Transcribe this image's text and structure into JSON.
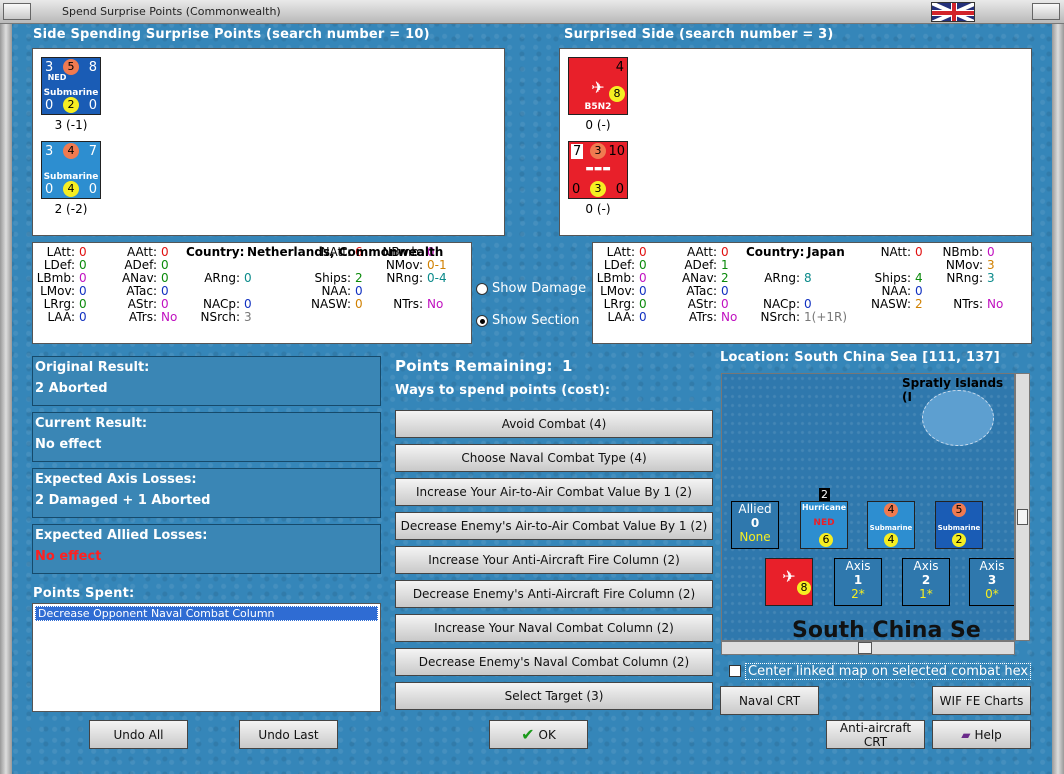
{
  "window": {
    "title": "Spend Surprise Points (Commonwealth)"
  },
  "left_side": {
    "header": "Side Spending Surprise Points (search number = 10)",
    "units": [
      {
        "tl": "3",
        "tc": "5",
        "tr": "8",
        "nation": "NED",
        "type": "Submarine",
        "bl": "0",
        "bc": "2",
        "br": "0",
        "caption": "3 (-1)",
        "color": "#1a5cb5"
      },
      {
        "tl": "3",
        "tc": "4",
        "tr": "7",
        "nation": "",
        "type": "Submarine",
        "bl": "0",
        "bc": "4",
        "br": "0",
        "caption": "2 (-2)",
        "color": "#2d8ed0"
      }
    ]
  },
  "right_side": {
    "header": "Surprised Side (search number = 3)",
    "units": [
      {
        "tl": "",
        "tc": "",
        "tr": "4",
        "type": "B5N2",
        "bc": "8",
        "caption": "0 (-)",
        "color": "#e8202a"
      },
      {
        "tl": "7",
        "tc": "3",
        "tr": "10",
        "type": "",
        "bl": "0",
        "bc": "3",
        "br": "0",
        "caption": "0 (-)",
        "color": "#e8202a"
      }
    ]
  },
  "left_stats": {
    "country_label": "Country:",
    "country": "Netherlands, Commonwealth",
    "LAtt": "0",
    "AAtt": "0",
    "NAtt": "6",
    "NBmb": "0",
    "LDef": "0",
    "ADef": "0",
    "Ships": "2",
    "NMov": "0-1",
    "LBmb": "0",
    "ANav": "0",
    "ARng": "0",
    "NAA": "0",
    "NRng": "0-4",
    "LMov": "0",
    "ATac": "0",
    "NASW": "0",
    "NTrs": "No",
    "LRrg": "0",
    "AStr": "0",
    "NACp": "0",
    "LAA": "0",
    "ATrs": "No",
    "NSrch": "3"
  },
  "right_stats": {
    "country_label": "Country:",
    "country": "Japan",
    "LAtt": "0",
    "AAtt": "0",
    "NAtt": "0",
    "NBmb": "0",
    "LDef": "0",
    "ADef": "1",
    "Ships": "4",
    "NMov": "3",
    "LBmb": "0",
    "ANav": "2",
    "ARng": "8",
    "NAA": "0",
    "NRng": "3",
    "LMov": "0",
    "ATac": "0",
    "NASW": "2",
    "NTrs": "No",
    "LRrg": "0",
    "AStr": "0",
    "NACp": "0",
    "LAA": "0",
    "ATrs": "No",
    "NSrch": "1(+1R)"
  },
  "labels": {
    "LAtt": "LAtt:",
    "AAtt": "AAtt:",
    "NAtt": "NAtt:",
    "NBmb": "NBmb:",
    "LDef": "LDef:",
    "ADef": "ADef:",
    "Ships": "Ships:",
    "NMov": "NMov:",
    "LBmb": "LBmb:",
    "ANav": "ANav:",
    "ARng": "ARng:",
    "NAA": "NAA:",
    "NRng": "NRng:",
    "LMov": "LMov:",
    "ATac": "ATac:",
    "NASW": "NASW:",
    "NTrs": "NTrs:",
    "LRrg": "LRrg:",
    "AStr": "AStr:",
    "NACp": "NACp:",
    "LAA": "LAA:",
    "ATrs": "ATrs:",
    "NSrch": "NSrch:"
  },
  "view": {
    "show_damage": "Show Damage",
    "show_section": "Show Section",
    "selected": "section"
  },
  "results": {
    "original_title": "Original Result:",
    "original_value": "2 Aborted",
    "current_title": "Current Result:",
    "current_value": "No effect",
    "axis_title": "Expected Axis Losses:",
    "axis_value": "2 Damaged + 1 Aborted",
    "allied_title": "Expected Allied Losses:",
    "allied_value": "No effect"
  },
  "points_spent": {
    "title": "Points Spent:",
    "items": [
      "Decrease Opponent Naval Combat Column"
    ]
  },
  "points": {
    "remaining_label": "Points Remaining:",
    "remaining_value": "1",
    "ways_label": "Ways to spend points (cost):"
  },
  "ways": [
    "Avoid Combat (4)",
    "Choose Naval Combat Type (4)",
    "Increase Your Air-to-Air Combat Value By 1 (2)",
    "Decrease Enemy's Air-to-Air Combat Value By 1 (2)",
    "Increase Your Anti-Aircraft Fire Column (2)",
    "Decrease Enemy's Anti-Aircraft Fire Column (2)",
    "Increase Your Naval Combat Column (2)",
    "Decrease Enemy's Naval Combat Column (2)",
    "Select Target (3)"
  ],
  "map": {
    "location": "Location: South China Sea [111, 137]",
    "island": "Spratly Islands (I",
    "sea": "South China Se",
    "allied_box": {
      "title": "Allied",
      "n": "0",
      "v": "None"
    },
    "axis_boxes": [
      {
        "title": "Axis",
        "n": "1",
        "v": "2*"
      },
      {
        "title": "Axis",
        "n": "2",
        "v": "1*"
      },
      {
        "title": "Axis",
        "n": "3",
        "v": "0*"
      }
    ],
    "stack_count": "2",
    "plane_name": "Hurricane",
    "plane_nation": "NED",
    "sub_label": "Submarine",
    "center_linked": "Center linked map on selected combat hex"
  },
  "buttons": {
    "naval_crt": "Naval CRT",
    "wif_fe": "WIF FE Charts",
    "aa_crt": "Anti-aircraft CRT",
    "help": "Help",
    "undo_all": "Undo All",
    "undo_last": "Undo Last",
    "ok": "OK"
  },
  "colors": {
    "value_red": "#e01010",
    "value_green": "#0a8a0a",
    "value_blue": "#1030c0",
    "value_magenta": "#c010c0",
    "value_orange": "#d08000",
    "value_teal": "#0a8a8a",
    "value_gray": "#777777"
  }
}
